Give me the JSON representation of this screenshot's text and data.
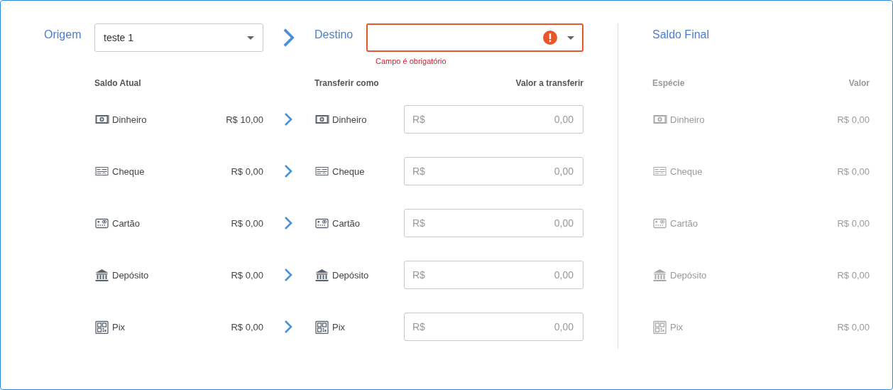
{
  "origin": {
    "label": "Origem",
    "value": "teste 1"
  },
  "destination": {
    "label": "Destino",
    "invalid": true,
    "error": "Campo é obrigatório"
  },
  "current_balance": {
    "header": "Saldo Atual",
    "rows": [
      {
        "kind": "cash",
        "name": "Dinheiro",
        "value": "R$ 10,00"
      },
      {
        "kind": "cheque",
        "name": "Cheque",
        "value": "R$ 0,00"
      },
      {
        "kind": "card",
        "name": "Cartão",
        "value": "R$ 0,00"
      },
      {
        "kind": "bank",
        "name": "Depósito",
        "value": "R$ 0,00"
      },
      {
        "kind": "pix",
        "name": "Pix",
        "value": "R$ 0,00"
      }
    ]
  },
  "transfer": {
    "header": "Transferir como",
    "amount_header": "Valor a transferir",
    "rows": [
      {
        "kind": "cash",
        "name": "Dinheiro",
        "prefix": "R$",
        "placeholder": "0,00"
      },
      {
        "kind": "cheque",
        "name": "Cheque",
        "prefix": "R$",
        "placeholder": "0,00"
      },
      {
        "kind": "card",
        "name": "Cartão",
        "prefix": "R$",
        "placeholder": "0,00"
      },
      {
        "kind": "bank",
        "name": "Depósito",
        "prefix": "R$",
        "placeholder": "0,00"
      },
      {
        "kind": "pix",
        "name": "Pix",
        "prefix": "R$",
        "placeholder": "0,00"
      }
    ]
  },
  "final_balance": {
    "title": "Saldo Final",
    "disabled": true,
    "columns": [
      "Espécie",
      "Valor"
    ],
    "rows": [
      {
        "kind": "cash",
        "name": "Dinheiro",
        "value": "R$ 0,00"
      },
      {
        "kind": "cheque",
        "name": "Cheque",
        "value": "R$ 0,00"
      },
      {
        "kind": "card",
        "name": "Cartão",
        "value": "R$ 0,00"
      },
      {
        "kind": "bank",
        "name": "Depósito",
        "value": "R$ 0,00"
      },
      {
        "kind": "pix",
        "name": "Pix",
        "value": "R$ 0,00"
      }
    ]
  }
}
